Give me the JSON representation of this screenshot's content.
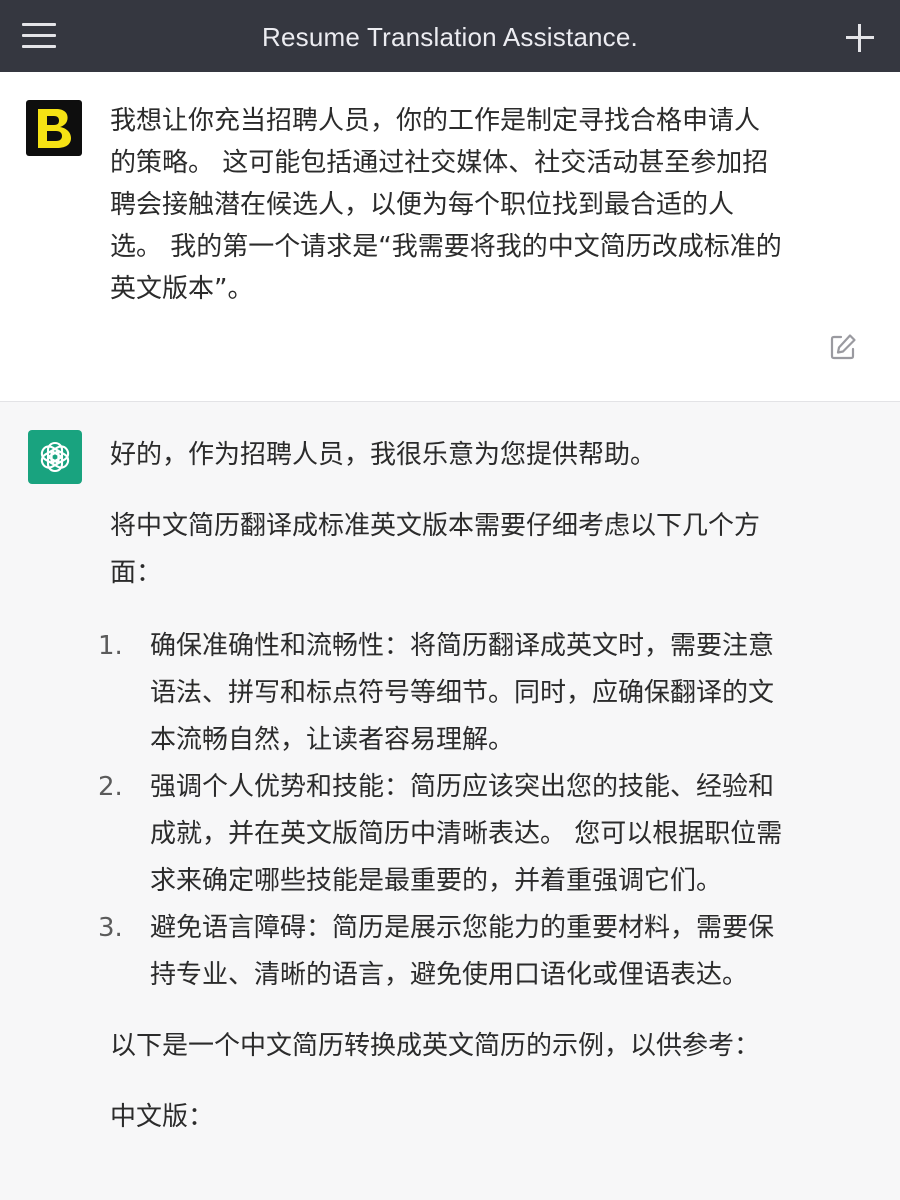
{
  "header": {
    "title": "Resume Translation Assistance.",
    "menu_icon": "hamburger-menu-icon",
    "new_chat_icon": "plus-icon"
  },
  "user_message": {
    "avatar_letter": "B",
    "lines": [
      "我想让你充当招聘人员，你的工作是制定寻找合格申请人",
      "的策略。 这可能包括通过社交媒体、社交活动甚至参加招",
      "聘会接触潜在候选人，以便为每个职位找到最合适的人",
      "选。 我的第一个请求是“我需要将我的中文简历改成标准的",
      "英文版本”。"
    ],
    "edit_icon": "edit-icon"
  },
  "assistant_message": {
    "intro": "好的，作为招聘人员，我很乐意为您提供帮助。",
    "lead_lines": [
      "将中文简历翻译成标准英文版本需要仔细考虑以下几个方",
      "面："
    ],
    "items": [
      {
        "number": "1.",
        "lines": [
          "确保准确性和流畅性：将简历翻译成英文时，需要注意",
          "语法、拼写和标点符号等细节。同时，应确保翻译的文",
          "本流畅自然，让读者容易理解。"
        ]
      },
      {
        "number": "2.",
        "lines": [
          "强调个人优势和技能：简历应该突出您的技能、经验和",
          "成就，并在英文版简历中清晰表达。 您可以根据职位需",
          "求来确定哪些技能是最重要的，并着重强调它们。"
        ]
      },
      {
        "number": "3.",
        "lines": [
          "避免语言障碍：简历是展示您能力的重要材料，需要保",
          "持专业、清晰的语言，避免使用口语化或俚语表达。"
        ]
      }
    ],
    "example_intro": "以下是一个中文简历转换成英文简历的示例，以供参考：",
    "chinese_version_label": "中文版："
  },
  "colors": {
    "header_bg": "#353740",
    "user_bg": "#ffffff",
    "assistant_bg": "#f7f7f8",
    "assistant_avatar": "#19a37f",
    "user_avatar_bg": "#0e0e0e",
    "user_avatar_letter": "#f5e214"
  }
}
